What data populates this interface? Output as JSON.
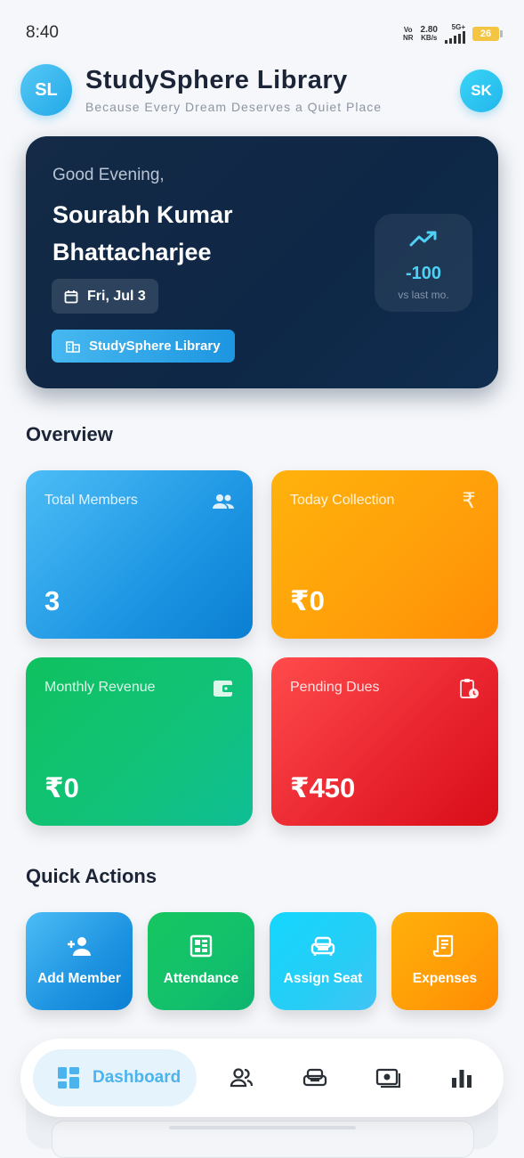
{
  "status_bar": {
    "time": "8:40",
    "network_top": "Vo",
    "network_bottom": "NR",
    "speed_value": "2.80",
    "speed_unit": "KB/s",
    "signal_type": "5G+",
    "battery": "26"
  },
  "header": {
    "logo_initials": "SL",
    "title": "StudySphere Library",
    "subtitle": "Because Every Dream Deserves a Quiet Place",
    "profile_initials": "SK"
  },
  "hero": {
    "greeting": "Good Evening,",
    "name": "Sourabh Kumar Bhattacharjee",
    "date": "Fri, Jul 3",
    "library": "StudySphere Library",
    "trend_value": "-100",
    "trend_label": "vs last mo."
  },
  "overview": {
    "title": "Overview",
    "cards": [
      {
        "label": "Total Members",
        "value": "3",
        "icon": "people-icon"
      },
      {
        "label": "Today Collection",
        "value": "₹0",
        "icon": "rupee-icon"
      },
      {
        "label": "Monthly Revenue",
        "value": "₹0",
        "icon": "wallet-icon"
      },
      {
        "label": "Pending Dues",
        "value": "₹450",
        "icon": "clipboard-clock-icon"
      }
    ]
  },
  "quick_actions": {
    "title": "Quick Actions",
    "items": [
      {
        "label": "Add Member",
        "icon": "person-add-icon"
      },
      {
        "label": "Attendance",
        "icon": "calendar-grid-icon"
      },
      {
        "label": "Assign Seat",
        "icon": "sofa-icon"
      },
      {
        "label": "Expenses",
        "icon": "receipt-icon"
      }
    ]
  },
  "bottom_nav": {
    "active_label": "Dashboard",
    "items": [
      "dashboard-icon",
      "people-icon",
      "sofa-icon",
      "cash-icon",
      "bar-chart-icon"
    ]
  },
  "colors": {
    "accent": "#2aa7ea",
    "hero_bg": "#0e2746",
    "members_card": "#1e96e3",
    "collection_card": "#ff9f0a",
    "revenue_card": "#11c27a",
    "dues_card": "#e8232e",
    "attendance": "#12c06c",
    "assign_seat": "#27cdf5",
    "expenses": "#ff9c06"
  }
}
